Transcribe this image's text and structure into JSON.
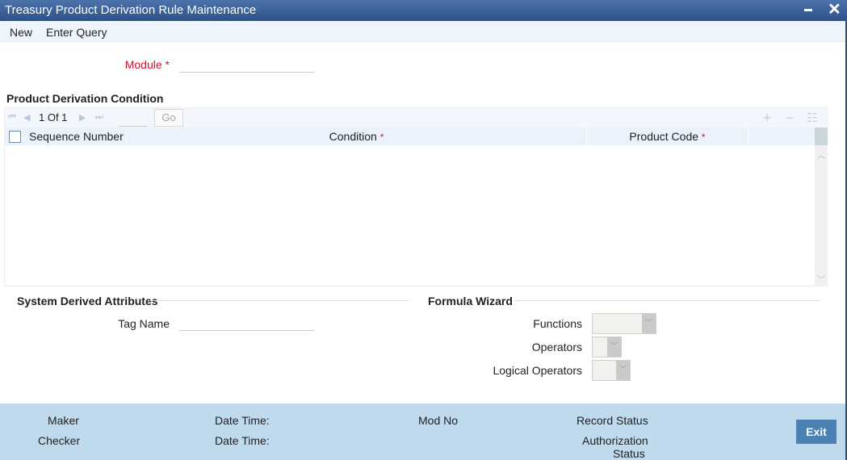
{
  "window": {
    "title": "Treasury Product Derivation Rule Maintenance",
    "minimize_icon": "minimize-icon",
    "close_icon": "close-icon"
  },
  "menu": {
    "items": [
      {
        "label": "New"
      },
      {
        "label": "Enter Query"
      }
    ]
  },
  "module": {
    "label": "Module",
    "required_mark": "*",
    "value": ""
  },
  "condition_section": {
    "title": "Product Derivation Condition",
    "pager": {
      "text": "1 Of 1",
      "page_value": "",
      "go_label": "Go"
    },
    "toolbar_icons": [
      "add-row-icon",
      "delete-row-icon",
      "single-view-icon"
    ],
    "columns": [
      {
        "label": "Sequence Number",
        "required": false
      },
      {
        "label": "Condition",
        "required": true,
        "mark": "*"
      },
      {
        "label": "Product Code",
        "required": true,
        "mark": "*"
      }
    ],
    "rows": []
  },
  "system_derived": {
    "title": "System Derived Attributes",
    "tag_name_label": "Tag Name",
    "tag_name_value": ""
  },
  "formula_wizard": {
    "title": "Formula Wizard",
    "functions_label": "Functions",
    "functions_value": "",
    "operators_label": "Operators",
    "operators_value": "",
    "logical_operators_label": "Logical Operators",
    "logical_operators_value": ""
  },
  "footer": {
    "maker_label": "Maker",
    "checker_label": "Checker",
    "maker_datetime_label": "Date Time:",
    "checker_datetime_label": "Date Time:",
    "mod_no_label": "Mod No",
    "record_status_label": "Record Status",
    "authorization_status_label_1": "Authorization",
    "authorization_status_label_2": "Status",
    "exit_label": "Exit"
  }
}
